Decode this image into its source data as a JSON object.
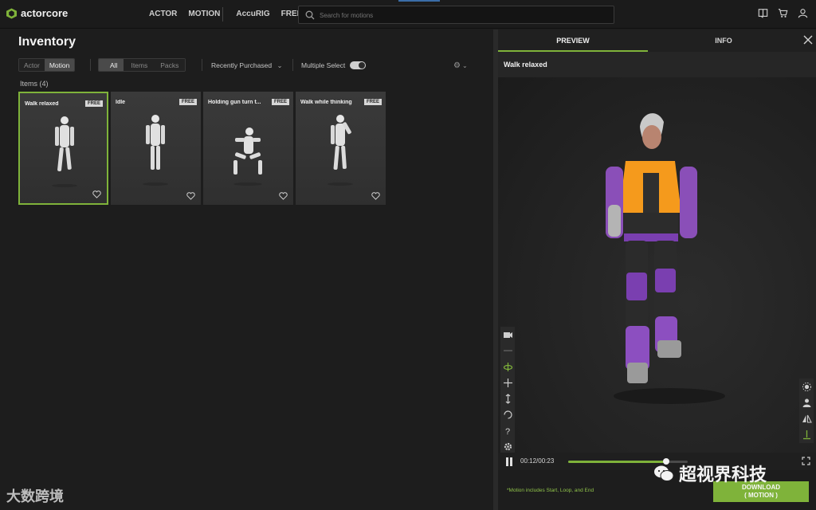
{
  "app": {
    "brand": "actorcore",
    "nav": [
      "ACTOR",
      "MOTION",
      "AccuRIG",
      "FREE"
    ],
    "search_placeholder": "Search for motions"
  },
  "inventory": {
    "title": "Inventory",
    "type_tabs": [
      "Actor",
      "Motion"
    ],
    "active_type_tab": "Motion",
    "filter_tabs": [
      "All",
      "Items",
      "Packs"
    ],
    "active_filter_tab": "All",
    "sort": "Recently Purchased",
    "multi_select_label": "Multiple Select",
    "items_count_label": "Items (4)",
    "items": [
      {
        "title": "Walk relaxed",
        "badge": "FREE",
        "selected": true
      },
      {
        "title": "Idle",
        "badge": "FREE",
        "selected": false
      },
      {
        "title": "Holding gun turn t...",
        "badge": "FREE",
        "selected": false
      },
      {
        "title": "Walk while thinking",
        "badge": "FREE",
        "selected": false
      }
    ]
  },
  "preview": {
    "tabs": [
      "PREVIEW",
      "INFO"
    ],
    "active_tab": "PREVIEW",
    "motion_name": "Walk relaxed",
    "time": "00:12/00:23",
    "progress": 0.82,
    "note": "*Motion includes Start, Loop, and End",
    "download_line1": "DOWNLOAD",
    "download_line2": "( MOTION )"
  },
  "watermarks": {
    "left": "大数跨境",
    "right": "超视界科技"
  },
  "colors": {
    "accent": "#7fb33a",
    "background": "#1d1d1d",
    "panel": "#262626"
  }
}
